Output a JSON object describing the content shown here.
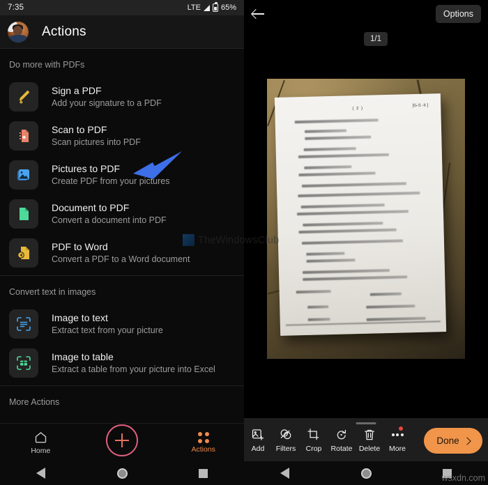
{
  "left": {
    "status": {
      "time": "7:35",
      "network": "LTE",
      "battery": "65%"
    },
    "header": {
      "title": "Actions",
      "avatar_name": "user-avatar"
    },
    "sections": [
      {
        "label": "Do more with PDFs"
      },
      {
        "label": "Convert text in images"
      },
      {
        "label": "More Actions"
      }
    ],
    "pdf_items": [
      {
        "title": "Sign a PDF",
        "subtitle": "Add your signature to a PDF",
        "icon": "pen-icon",
        "color": "#e8b93a"
      },
      {
        "title": "Scan to PDF",
        "subtitle": "Scan pictures into PDF",
        "icon": "scan-document-icon",
        "color": "#e98369"
      },
      {
        "title": "Pictures to PDF",
        "subtitle": "Create PDF from your pictures",
        "icon": "picture-icon",
        "color": "#4aa3f0"
      },
      {
        "title": "Document to PDF",
        "subtitle": "Convert a document into PDF",
        "icon": "document-icon",
        "color": "#4fd99b"
      },
      {
        "title": "PDF to Word",
        "subtitle": "Convert a PDF to a Word document",
        "icon": "pdf-to-word-icon",
        "color": "#e8b93a"
      }
    ],
    "text_items": [
      {
        "title": "Image to text",
        "subtitle": "Extract text from your picture",
        "icon": "image-to-text-icon",
        "color": "#4aa3f0"
      },
      {
        "title": "Image to table",
        "subtitle": "Extract a table from your picture into Excel",
        "icon": "image-to-table-icon",
        "color": "#4fd99b"
      }
    ],
    "bottom_nav": [
      {
        "label": "Home",
        "icon": "home-icon",
        "active": false
      },
      {
        "label": "",
        "icon": "plus-fab-icon",
        "active": false
      },
      {
        "label": "Actions",
        "icon": "grid-icon",
        "active": true
      }
    ],
    "system_nav": [
      "back-icon",
      "home-circle-icon",
      "recents-square-icon"
    ]
  },
  "right": {
    "back_icon": "back-arrow-icon",
    "options_label": "Options",
    "page_indicator": "1/1",
    "photo": {
      "alt": "scanned-paper-photo",
      "paper_header": "( 2 )",
      "paper_code": "[G-S -II ]"
    },
    "toolbar": [
      {
        "label": "Add",
        "icon": "add-image-icon"
      },
      {
        "label": "Filters",
        "icon": "filters-icon"
      },
      {
        "label": "Crop",
        "icon": "crop-icon"
      },
      {
        "label": "Rotate",
        "icon": "rotate-icon"
      },
      {
        "label": "Delete",
        "icon": "trash-icon"
      },
      {
        "label": "More",
        "icon": "more-dots-icon",
        "badge": true
      }
    ],
    "done_label": "Done",
    "system_nav": [
      "back-icon",
      "home-circle-icon",
      "recents-square-icon"
    ]
  },
  "watermarks": {
    "primary": "TheWindowsClub",
    "secondary": "wsxdn.com"
  },
  "colors": {
    "accent_orange": "#f08a4b",
    "done_button": "#f0954a",
    "fab_ring": "#e0607f",
    "annotation_arrow": "#3d6fe8",
    "badge_red": "#e8463a"
  }
}
